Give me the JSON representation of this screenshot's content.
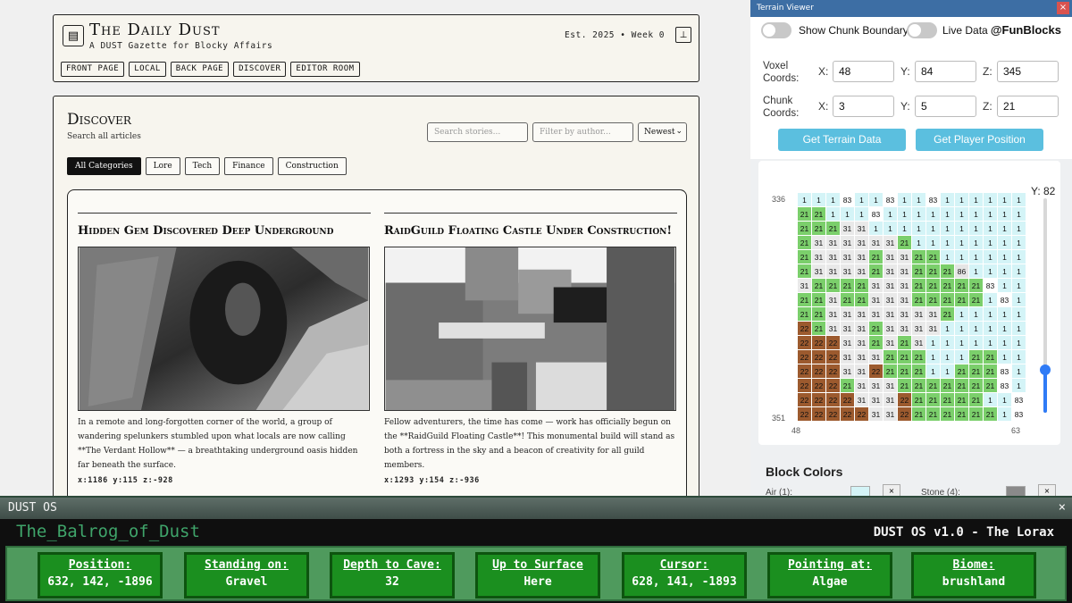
{
  "site": {
    "title": "The Daily Dust",
    "subtitle": "A DUST Gazette for Blocky Affairs",
    "est": "Est. 2025 • Week 0",
    "nav": [
      "FRONT PAGE",
      "LOCAL",
      "BACK PAGE",
      "DISCOVER",
      "EDITOR ROOM"
    ],
    "page_title": "Discover",
    "page_sub": "Search all articles",
    "search_placeholder": "Search stories...",
    "author_placeholder": "Filter by author...",
    "sort_value": "Newest",
    "categories": [
      "All Categories",
      "Lore",
      "Tech",
      "Finance",
      "Construction"
    ],
    "articles": [
      {
        "title": "Hidden Gem Discovered Deep Underground",
        "body": "In a remote and long-forgotten corner of the world, a group of wandering spelunkers stumbled upon what locals are now calling **The Verdant Hollow** — a breathtaking underground oasis hidden far beneath the surface.",
        "coords": "x:1186 y:115 z:-928"
      },
      {
        "title": "RaidGuild Floating Castle Under Construction!",
        "body": "Fellow adventurers, the time has come — work has officially begun on the **RaidGuild Floating Castle**! This monumental build will stand as both a fortress in the sky and a beacon of creativity for all guild members.",
        "coords": "x:1293 y:154 z:-936"
      }
    ]
  },
  "terrain": {
    "window_title": "Terrain Viewer",
    "toggle_chunk": "Show Chunk Boundary",
    "toggle_live": "Live Data",
    "brand": "@FunBlocks",
    "voxel_label": "Voxel Coords:",
    "chunk_label": "Chunk Coords:",
    "axes": [
      "X:",
      "Y:",
      "Z:"
    ],
    "voxel": {
      "x": "48",
      "y": "84",
      "z": "345"
    },
    "chunk": {
      "x": "3",
      "y": "5",
      "z": "21"
    },
    "btn_terrain": "Get Terrain Data",
    "btn_player": "Get Player Position",
    "y_label": "Y: 82",
    "y_fraction": 0.2,
    "row_start": "336",
    "row_end": "351",
    "col_start": "48",
    "col_end": "63",
    "grid": [
      [
        1,
        1,
        1,
        83,
        1,
        1,
        83,
        1,
        1,
        83,
        1,
        1,
        1,
        1,
        1,
        1
      ],
      [
        21,
        21,
        1,
        1,
        1,
        83,
        1,
        1,
        1,
        1,
        1,
        1,
        1,
        1,
        1,
        1
      ],
      [
        21,
        21,
        21,
        31,
        31,
        1,
        1,
        1,
        1,
        1,
        1,
        1,
        1,
        1,
        1,
        1
      ],
      [
        21,
        31,
        31,
        31,
        31,
        31,
        31,
        21,
        1,
        1,
        1,
        1,
        1,
        1,
        1,
        1
      ],
      [
        21,
        31,
        31,
        31,
        31,
        21,
        31,
        31,
        21,
        21,
        1,
        1,
        1,
        1,
        1,
        1
      ],
      [
        21,
        31,
        31,
        31,
        31,
        21,
        31,
        31,
        21,
        21,
        21,
        86,
        1,
        1,
        1,
        1
      ],
      [
        31,
        21,
        21,
        21,
        21,
        31,
        31,
        31,
        21,
        21,
        21,
        21,
        21,
        83,
        1,
        1
      ],
      [
        21,
        21,
        31,
        21,
        21,
        31,
        31,
        31,
        21,
        21,
        21,
        21,
        21,
        1,
        83,
        1
      ],
      [
        21,
        21,
        31,
        31,
        31,
        31,
        31,
        31,
        31,
        31,
        21,
        1,
        1,
        1,
        1,
        1
      ],
      [
        22,
        21,
        31,
        31,
        31,
        21,
        31,
        31,
        31,
        31,
        1,
        1,
        1,
        1,
        1,
        1
      ],
      [
        22,
        22,
        22,
        31,
        31,
        21,
        31,
        21,
        31,
        1,
        1,
        1,
        1,
        1,
        1,
        1
      ],
      [
        22,
        22,
        22,
        31,
        31,
        31,
        21,
        21,
        21,
        1,
        1,
        1,
        21,
        21,
        1,
        1
      ],
      [
        22,
        22,
        22,
        31,
        31,
        22,
        21,
        21,
        21,
        1,
        1,
        21,
        21,
        21,
        83,
        1
      ],
      [
        22,
        22,
        22,
        21,
        31,
        31,
        31,
        21,
        21,
        21,
        21,
        21,
        21,
        21,
        83,
        1
      ],
      [
        22,
        22,
        22,
        22,
        31,
        31,
        31,
        22,
        21,
        21,
        21,
        21,
        21,
        1,
        1,
        83
      ],
      [
        22,
        22,
        22,
        22,
        22,
        31,
        31,
        22,
        21,
        21,
        21,
        21,
        21,
        21,
        1,
        83
      ]
    ],
    "block_colors_title": "Block Colors",
    "block_rows": [
      {
        "label": "Air (1):",
        "color": "#d4f4f7"
      },
      {
        "label": "Stone (4):",
        "color": "#8a8a8a"
      }
    ]
  },
  "hud": {
    "title": "DUST OS",
    "close": "×",
    "user": "The_Balrog_of_Dust",
    "version": "DUST OS v1.0 - The Lorax",
    "cards": [
      {
        "label": "Position:",
        "value": "632, 142, -1896"
      },
      {
        "label": "Standing on:",
        "value": "Gravel"
      },
      {
        "label": "Depth to Cave:",
        "value": "32"
      },
      {
        "label": "Up to Surface",
        "value": "Here"
      },
      {
        "label": "Cursor:",
        "value": "628, 141, -1893"
      },
      {
        "label": "Pointing at:",
        "value": "Algae"
      },
      {
        "label": "Biome:",
        "value": "brushland"
      }
    ]
  }
}
